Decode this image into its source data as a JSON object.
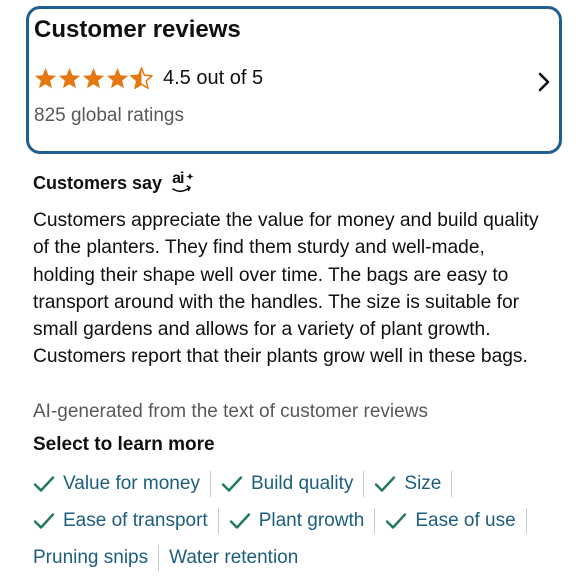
{
  "reviews": {
    "title": "Customer reviews",
    "rating": 4.5,
    "rating_max": 5,
    "rating_text": "4.5 out of 5",
    "ratings_count_text": "825 global ratings",
    "star_color": "#e47911",
    "border_color": "#1f5f8f"
  },
  "customers_say": {
    "title": "Customers say",
    "ai_badge_text": "ai",
    "summary": "Customers appreciate the value for money and build quality of the planters. They find them sturdy and well-made, holding their shape well over time. The bags are easy to transport around with the handles. The size is suitable for small gardens and allows for a variety of plant growth. Customers report that their plants grow well in these bags.",
    "ai_note": "AI-generated from the text of customer reviews",
    "select_label": "Select to learn more"
  },
  "aspects": [
    {
      "label": "Value for money",
      "checked": true
    },
    {
      "label": "Build quality",
      "checked": true
    },
    {
      "label": "Size",
      "checked": true
    },
    {
      "label": "Ease of transport",
      "checked": true
    },
    {
      "label": "Plant growth",
      "checked": true
    },
    {
      "label": "Ease of use",
      "checked": true
    },
    {
      "label": "Pruning snips",
      "checked": false
    },
    {
      "label": "Water retention",
      "checked": false
    }
  ],
  "colors": {
    "link": "#1b5e7e",
    "check": "#1f7a5c",
    "secondary_text": "#565959"
  },
  "icons": {
    "star": "star-icon",
    "chevron": "chevron-right-icon",
    "check": "checkmark-icon",
    "ai": "ai-sparkle-icon"
  }
}
